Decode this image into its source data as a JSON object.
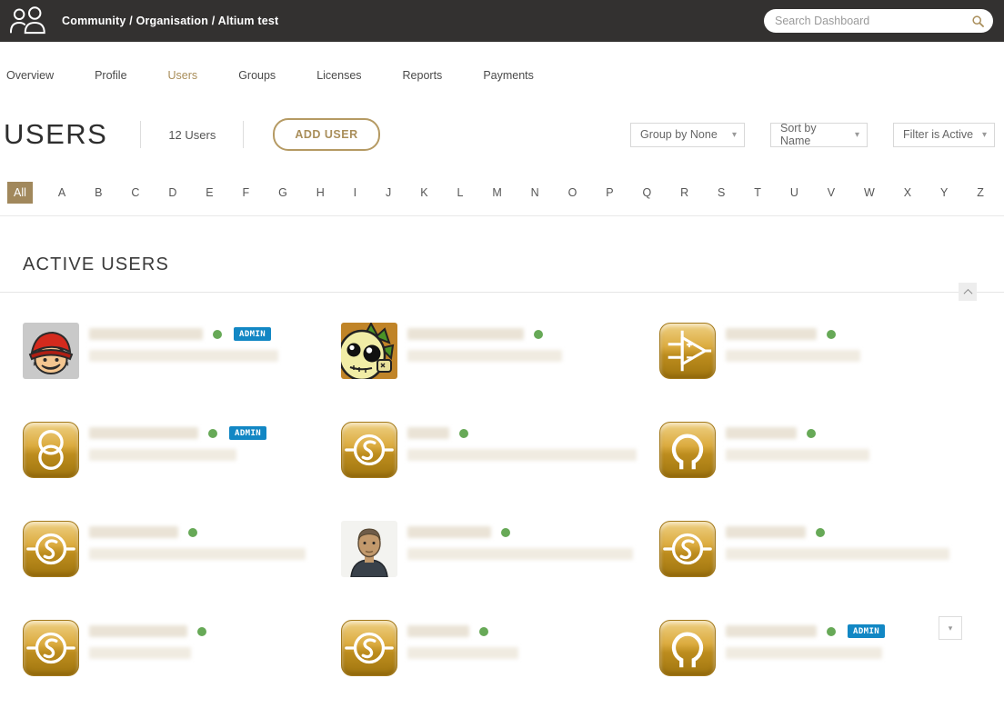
{
  "colors": {
    "topbar_bg": "#333130",
    "accent_gold": "#A1885C",
    "admin_badge_blue": "#1287C4",
    "online_green": "#67A957"
  },
  "header": {
    "breadcrumb": "Community / Organisation / Altium test",
    "search_placeholder": "Search Dashboard",
    "logo_icon": "community-people-icon",
    "search_icon": "search-icon"
  },
  "nav": {
    "tabs": [
      {
        "label": "Overview",
        "active": false
      },
      {
        "label": "Profile",
        "active": false
      },
      {
        "label": "Users",
        "active": true
      },
      {
        "label": "Groups",
        "active": false
      },
      {
        "label": "Licenses",
        "active": false
      },
      {
        "label": "Reports",
        "active": false
      },
      {
        "label": "Payments",
        "active": false
      }
    ]
  },
  "toolbar": {
    "title": "USERS",
    "count": "12 Users",
    "add_user_label": "ADD USER",
    "group_by": "Group by None",
    "sort_by": "Sort by Name",
    "filter": "Filter is Active",
    "caret": "▾"
  },
  "alphabet": {
    "selected": "All",
    "items": [
      "All",
      "A",
      "B",
      "C",
      "D",
      "E",
      "F",
      "G",
      "H",
      "I",
      "J",
      "K",
      "L",
      "M",
      "N",
      "O",
      "P",
      "Q",
      "R",
      "S",
      "T",
      "U",
      "V",
      "W",
      "X",
      "Y",
      "Z"
    ]
  },
  "sections": {
    "active_users_title": "ACTIVE USERS"
  },
  "badges": {
    "admin": "ADMIN"
  },
  "users": [
    {
      "avatar": "cartoon-boy",
      "online": true,
      "admin": true,
      "menu": false,
      "name_width": 125,
      "email_width": 208
    },
    {
      "avatar": "dragon",
      "online": true,
      "admin": false,
      "menu": false,
      "name_width": 128,
      "email_width": 170
    },
    {
      "avatar": "opamp",
      "online": true,
      "admin": false,
      "menu": false,
      "name_width": 100,
      "email_width": 148
    },
    {
      "avatar": "circles",
      "online": true,
      "admin": true,
      "menu": false,
      "name_width": 120,
      "email_width": 162
    },
    {
      "avatar": "ac-source",
      "online": true,
      "admin": false,
      "menu": false,
      "name_width": 46,
      "email_width": 252
    },
    {
      "avatar": "omega",
      "online": true,
      "admin": false,
      "menu": false,
      "name_width": 78,
      "email_width": 158
    },
    {
      "avatar": "ac-source",
      "online": true,
      "admin": false,
      "menu": false,
      "name_width": 98,
      "email_width": 238
    },
    {
      "avatar": "man",
      "online": true,
      "admin": false,
      "menu": false,
      "name_width": 92,
      "email_width": 248
    },
    {
      "avatar": "ac-source",
      "online": true,
      "admin": false,
      "menu": false,
      "name_width": 88,
      "email_width": 246
    },
    {
      "avatar": "ac-source",
      "online": true,
      "admin": false,
      "menu": false,
      "name_width": 108,
      "email_width": 112
    },
    {
      "avatar": "ac-source",
      "online": true,
      "admin": false,
      "menu": false,
      "name_width": 68,
      "email_width": 122
    },
    {
      "avatar": "omega",
      "online": true,
      "admin": true,
      "menu": true,
      "name_width": 100,
      "email_width": 172
    }
  ]
}
